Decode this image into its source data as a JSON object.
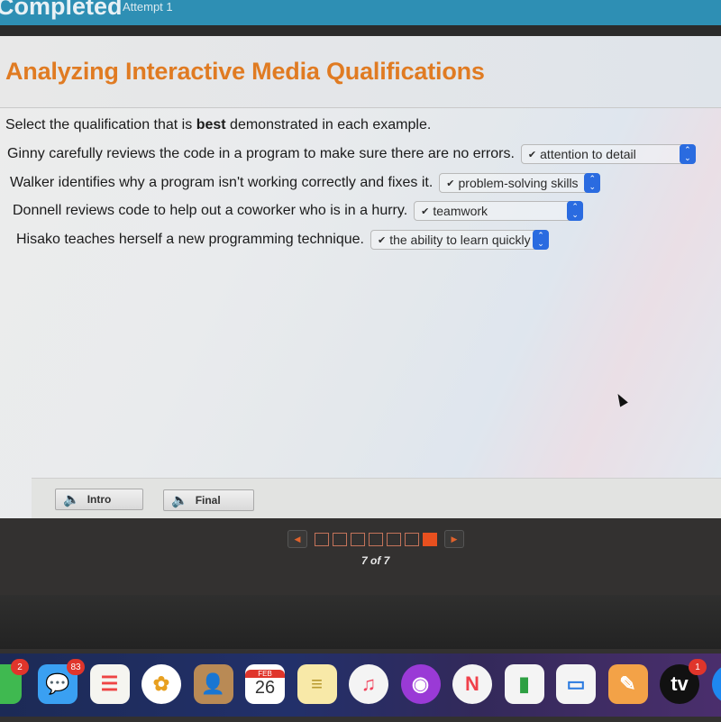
{
  "header": {
    "status": "Completed",
    "attempt": "Attempt 1"
  },
  "activity": {
    "title": "Analyzing Interactive Media Qualifications",
    "instruction_prefix": "Select the qualification that is ",
    "instruction_bold": "best",
    "instruction_suffix": " demonstrated in each example.",
    "items": [
      {
        "question": "Ginny carefully reviews the code in a program to make sure there are no errors.",
        "selected": "attention to detail"
      },
      {
        "question": "Walker identifies why a program isn't working correctly and fixes it.",
        "selected": "problem-solving skills"
      },
      {
        "question": "Donnell reviews code to help out a coworker who is in a hurry.",
        "selected": "teamwork"
      },
      {
        "question": "Hisako teaches herself a new programming technique.",
        "selected": "the ability to learn quickly"
      }
    ],
    "check_glyph": "✔",
    "arrow_up": "⌃",
    "arrow_down": "⌄"
  },
  "footer": {
    "intro_label": "Intro",
    "final_label": "Final",
    "speaker_glyph": "🔈"
  },
  "pager": {
    "total": 7,
    "current": 7,
    "label": "7 of 7",
    "prev_glyph": "◀",
    "next_glyph": "▶"
  },
  "dock": {
    "items": [
      {
        "name": "messages",
        "glyph": "💬",
        "badge": "83",
        "bg": "#3aa0f2"
      },
      {
        "name": "reminders",
        "glyph": "☰",
        "badge": "",
        "bg": "#f5f5f0"
      },
      {
        "name": "photos",
        "glyph": "✿",
        "badge": "",
        "bg": "#ffffff"
      },
      {
        "name": "contacts",
        "glyph": "👤",
        "badge": "",
        "bg": "#b98a55"
      },
      {
        "name": "calendar",
        "glyph": "26",
        "badge": "",
        "bg": "#ffffff",
        "month": "FEB"
      },
      {
        "name": "notes",
        "glyph": "≡",
        "badge": "",
        "bg": "#f8e9a8"
      },
      {
        "name": "music",
        "glyph": "♫",
        "badge": "",
        "bg": "#f4f4f4"
      },
      {
        "name": "podcasts",
        "glyph": "◉",
        "badge": "",
        "bg": "#9a3ad6"
      },
      {
        "name": "news",
        "glyph": "N",
        "badge": "",
        "bg": "#f4f4f4"
      },
      {
        "name": "numbers",
        "glyph": "▮",
        "badge": "",
        "bg": "#f4f4f4"
      },
      {
        "name": "keynote",
        "glyph": "▭",
        "badge": "",
        "bg": "#f4f4f4"
      },
      {
        "name": "pages",
        "glyph": "✎",
        "badge": "",
        "bg": "#f3a247"
      },
      {
        "name": "apple-tv",
        "glyph": "tv",
        "badge": "1",
        "bg": "#111111"
      },
      {
        "name": "app-store",
        "glyph": "A",
        "badge": "",
        "bg": "#1e88f0"
      }
    ],
    "partial_left_badge": "2"
  }
}
